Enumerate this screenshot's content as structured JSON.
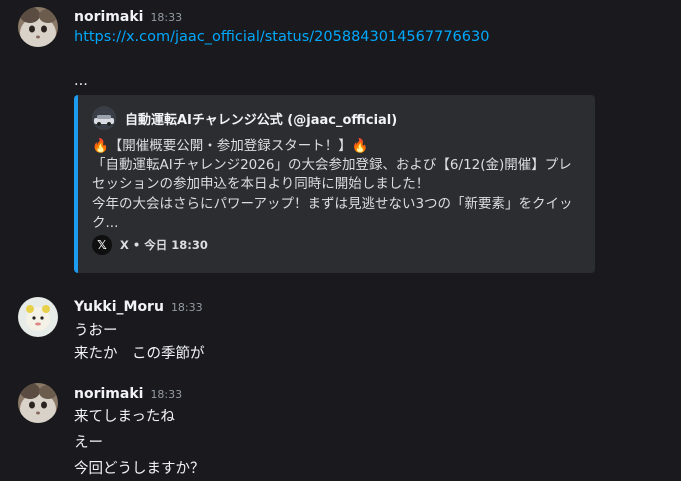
{
  "messages": [
    {
      "username": "norimaki",
      "time": "18:33",
      "link": "https://x.com/jaac_official/status/2058843014567776630",
      "ellipsis": "...",
      "embed": {
        "author": "自動運転AIチャレンジ公式 (@jaac_official)",
        "lines": [
          "🔥【開催概要公開・参加登録スタート！】🔥",
          "「自動運転AIチャレンジ2026」の大会参加登録、および【6/12(金)開催】プレ",
          "セッションの参加申込を本日より同時に開始しました！",
          "今年の大会はさらにパワーアップ！まずは見逃せない3つの「新要素」をクイッ",
          "ク..."
        ],
        "footer": "X • 今日 18:30",
        "accent_color": "#1d9bf0"
      }
    },
    {
      "username": "Yukki_Moru",
      "time": "18:33",
      "lines": [
        "うおー",
        "来たか　この季節が"
      ]
    },
    {
      "username": "norimaki",
      "time": "18:33",
      "lines": [
        "来てしまったね",
        "えー",
        "今回どうしますか？"
      ]
    }
  ],
  "icons": {
    "x_logo": "𝕏"
  }
}
